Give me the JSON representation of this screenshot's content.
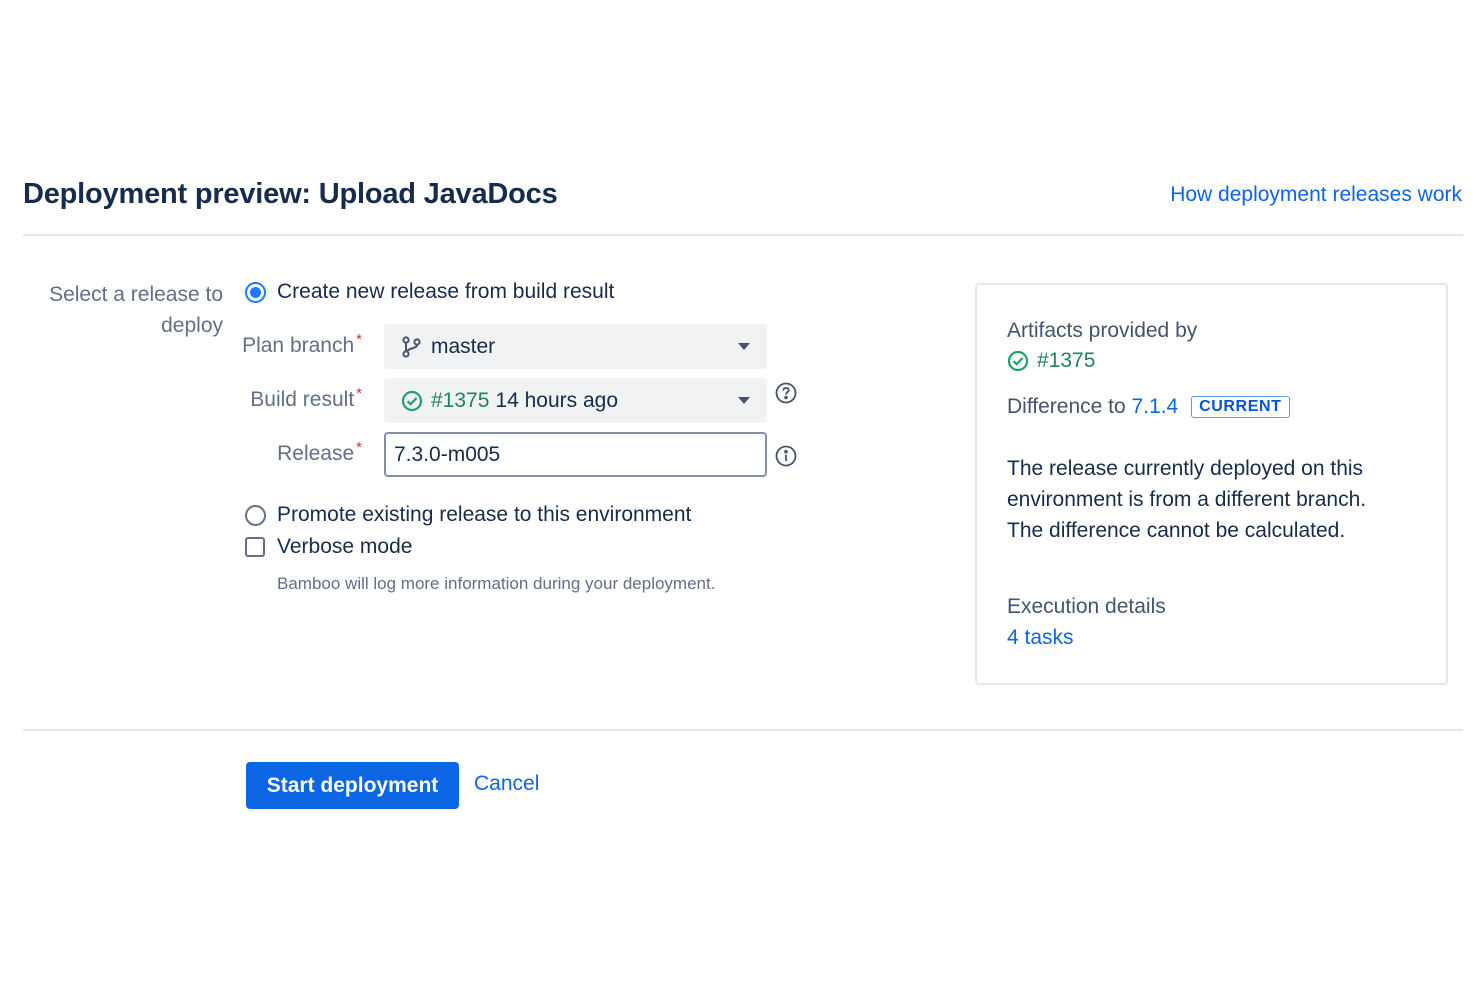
{
  "header": {
    "title": "Deployment preview: Upload JavaDocs",
    "help_link": "How deployment releases work"
  },
  "form": {
    "select_release_label": "Select a release to deploy",
    "option_create": "Create new release from build result",
    "plan_branch_label": "Plan branch",
    "plan_branch_value": "master",
    "build_result_label": "Build result",
    "build_result_number": "#1375",
    "build_result_time": "14 hours ago",
    "release_label": "Release",
    "release_value": "7.3.0-m005",
    "required_marker": "*",
    "option_promote": "Promote existing release to this environment",
    "verbose_label": "Verbose mode",
    "verbose_help": "Bamboo will log more information during your deployment.",
    "selected_option": "create",
    "verbose_checked": false
  },
  "panel": {
    "artifacts_label": "Artifacts provided by",
    "artifacts_build": "#1375",
    "difference_label": "Difference to",
    "difference_version": "7.1.4",
    "current_badge": "CURRENT",
    "description": "The release currently deployed on this environment is from a different branch. The difference cannot be calculated.",
    "execution_label": "Execution details",
    "execution_tasks": "4 tasks"
  },
  "footer": {
    "start_label": "Start deployment",
    "cancel_label": "Cancel"
  },
  "icons": {
    "branch": "branch-icon",
    "success": "check-circle-icon",
    "help": "question-circle-icon",
    "info": "info-circle-icon",
    "caret": "chevron-down-icon"
  },
  "colors": {
    "primary": "#0c66e4",
    "success": "#22a06b",
    "required": "#c9372c",
    "radio_selected": "#1d7afc"
  }
}
